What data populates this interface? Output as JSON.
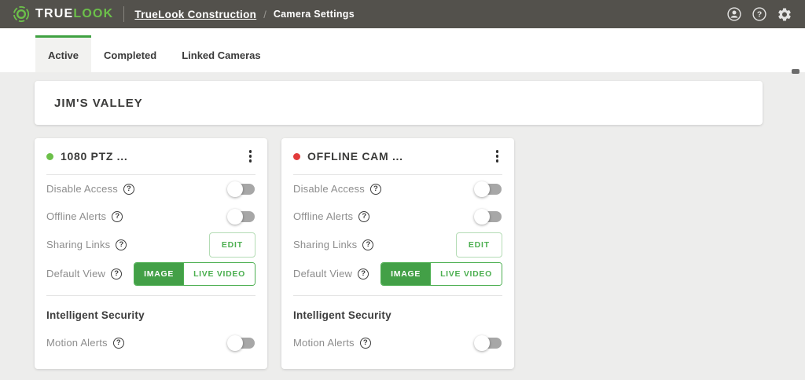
{
  "header": {
    "brand": {
      "part1": "TRUE",
      "part2": "LOOK"
    },
    "breadcrumb": {
      "account_link": "TrueLook Construction",
      "separator": "/",
      "current_page": "Camera Settings"
    }
  },
  "tabs": {
    "active": "Active",
    "completed": "Completed",
    "linked_cameras": "Linked Cameras"
  },
  "project": {
    "name": "JIM'S VALLEY"
  },
  "cards": [
    {
      "title": "1080 PTZ ...",
      "status": "online"
    },
    {
      "title": "OFFLINE CAM ...",
      "status": "offline"
    }
  ],
  "rows": {
    "disable_access": {
      "label": "Disable Access",
      "control": "toggle",
      "value": "off"
    },
    "offline_alerts": {
      "label": "Offline Alerts",
      "control": "toggle",
      "value": "off"
    },
    "sharing_links": {
      "label": "Sharing Links",
      "control": "button",
      "button_label": "EDIT"
    },
    "default_view": {
      "label": "Default View",
      "control": "segmented",
      "option_image": "IMAGE",
      "option_live_video": "LIVE VIDEO",
      "selected": "IMAGE"
    },
    "motion_alerts": {
      "label": "Motion Alerts",
      "control": "toggle",
      "value": "off"
    }
  },
  "sections": {
    "intelligent_security": "Intelligent Security"
  },
  "help_glyph": "?",
  "colors": {
    "header_bg": "#53514c",
    "brand_green": "#6cc04a",
    "accent_green": "#43a047",
    "tab_indicator_green": "#3fa142",
    "page_bg": "#ededec",
    "label_gray": "#8d8d8d",
    "online_dot": "#6cc04a",
    "offline_dot": "#e23b3b"
  }
}
